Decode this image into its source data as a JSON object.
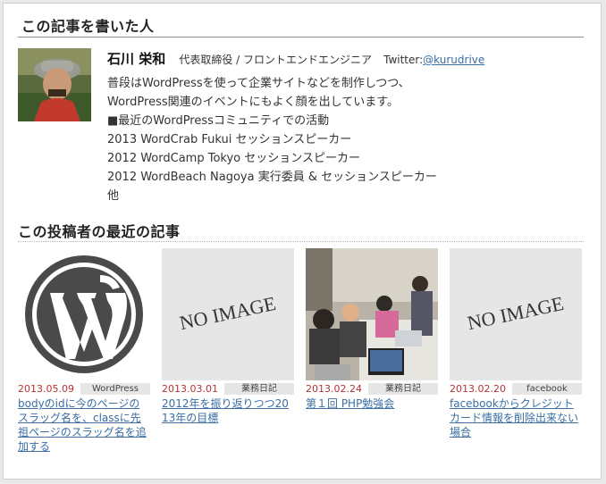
{
  "author_section": {
    "title": "この記事を書いた人",
    "name": "石川 栄和",
    "role": "代表取締役 / フロントエンドエンジニア",
    "twitter_label": "Twitter:",
    "twitter_handle": "@kurudrive",
    "bio_lines": [
      "普段はWordPressを使って企業サイトなどを制作しつつ、",
      "WordPress関連のイベントにもよく顔を出しています。",
      "■最近のWordPressコミュニティでの活動",
      "2013 WordCrab Fukui セッションスピーカー",
      "2012 WordCamp Tokyo セッションスピーカー",
      "2012 WordBeach Nagoya 実行委員 & セッションスピーカー",
      "他"
    ]
  },
  "recent_section": {
    "title": "この投稿者の最近の記事",
    "no_image_text": "NO IMAGE",
    "posts": [
      {
        "date": "2013.05.09",
        "category": "WordPress",
        "title": "bodyのidに今のページのスラッグ名を、classに先祖ページのスラッグ名を追加する",
        "thumbnail": "wordpress-logo"
      },
      {
        "date": "2013.03.01",
        "category": "業務日記",
        "title": "2012年を振り返りつつ2013年の目標",
        "thumbnail": "no-image"
      },
      {
        "date": "2013.02.24",
        "category": "業務日記",
        "title": "第１回 PHP勉強会",
        "thumbnail": "photo-study-meeting"
      },
      {
        "date": "2013.02.20",
        "category": "facebook",
        "title": "facebookからクレジットカード情報を削除出来ない場合",
        "thumbnail": "no-image"
      }
    ]
  },
  "colors": {
    "link": "#3a6ea5",
    "date": "#b83232",
    "category_bg": "#e6e6e6"
  }
}
